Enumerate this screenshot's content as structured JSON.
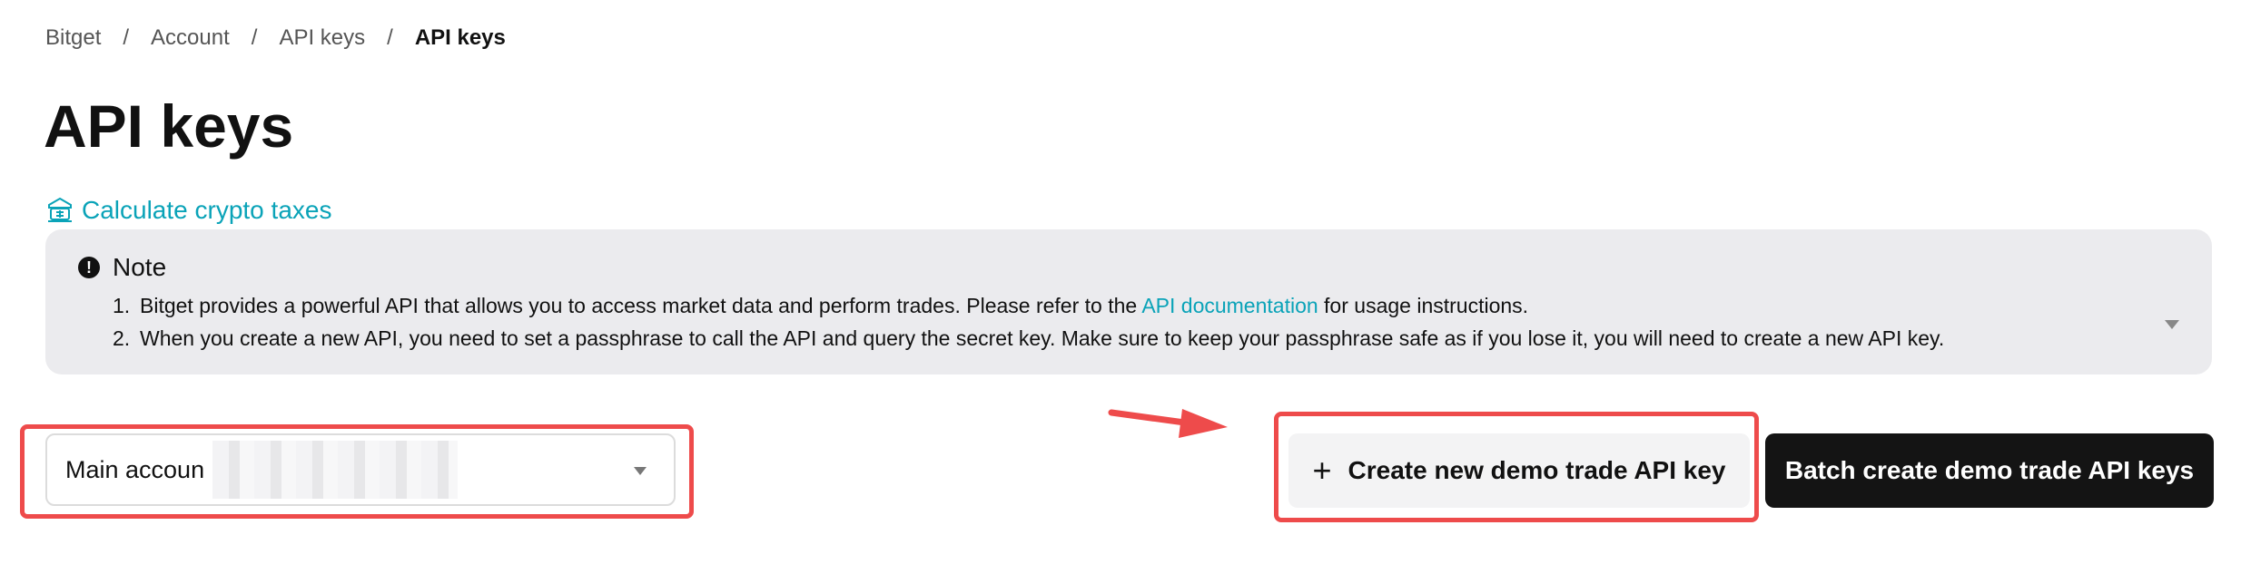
{
  "breadcrumb": {
    "items": [
      "Bitget",
      "Account",
      "API keys"
    ],
    "separator": "/",
    "current": "API keys"
  },
  "page": {
    "title": "API keys"
  },
  "tax_link": {
    "label": "Calculate crypto taxes",
    "icon": "tax-calculator-icon"
  },
  "note": {
    "title": "Note",
    "items": [
      {
        "num": "1.",
        "before": "Bitget provides a powerful API that allows you to access market data and perform trades. Please refer to the ",
        "link": "API documentation",
        "after": " for usage instructions."
      },
      {
        "num": "2.",
        "text": "When you create a new API, you need to set a passphrase to call the API and query the secret key. Make sure to keep your passphrase safe as if you lose it, you will need to create a new API key."
      }
    ]
  },
  "account_select": {
    "value": "Main accoun"
  },
  "buttons": {
    "create_demo": "Create new demo trade API key",
    "batch_create_demo": "Batch create demo trade API keys"
  },
  "colors": {
    "accent": "#0aa3b8",
    "highlight": "#ee4b4b",
    "note_bg": "#ebebee",
    "primary_button": "#141414"
  }
}
